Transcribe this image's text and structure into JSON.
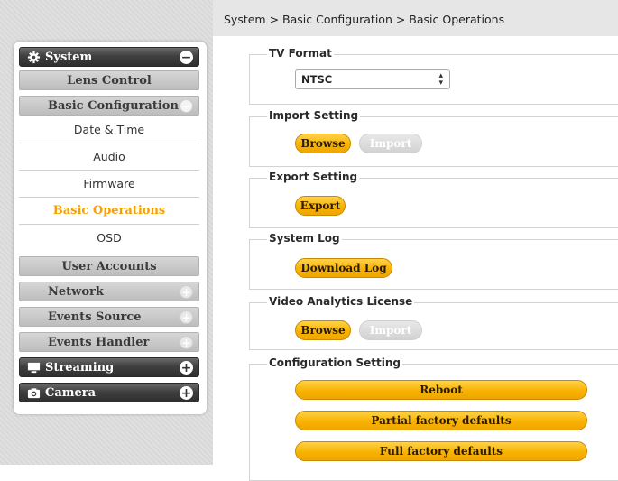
{
  "breadcrumb": "System > Basic Configuration > Basic Operations",
  "menu": {
    "system": "System",
    "lens_control": "Lens Control",
    "basic_configuration": "Basic Configuration",
    "sub_items": [
      "Date & Time",
      "Audio",
      "Firmware",
      "Basic Operations",
      "OSD"
    ],
    "user_accounts": "User Accounts",
    "network": "Network",
    "events_source": "Events Source",
    "events_handler": "Events Handler",
    "streaming": "Streaming",
    "camera": "Camera",
    "active_item": "Basic Operations"
  },
  "sections": {
    "tv_format": {
      "title": "TV Format",
      "selected": "NTSC"
    },
    "import_setting": {
      "title": "Import Setting",
      "browse": "Browse",
      "import": "Import"
    },
    "export_setting": {
      "title": "Export Setting",
      "export": "Export"
    },
    "system_log": {
      "title": "System Log",
      "download": "Download Log"
    },
    "video_analytics": {
      "title": "Video Analytics License",
      "browse": "Browse",
      "import": "Import"
    },
    "configuration": {
      "title": "Configuration Setting",
      "reboot": "Reboot",
      "partial": "Partial factory defaults",
      "full": "Full factory defaults"
    }
  },
  "colors": {
    "accent": "#f8b300",
    "active_text": "#f5a000",
    "dark_header": "#404040",
    "gray_item": "#c9c9c9"
  }
}
